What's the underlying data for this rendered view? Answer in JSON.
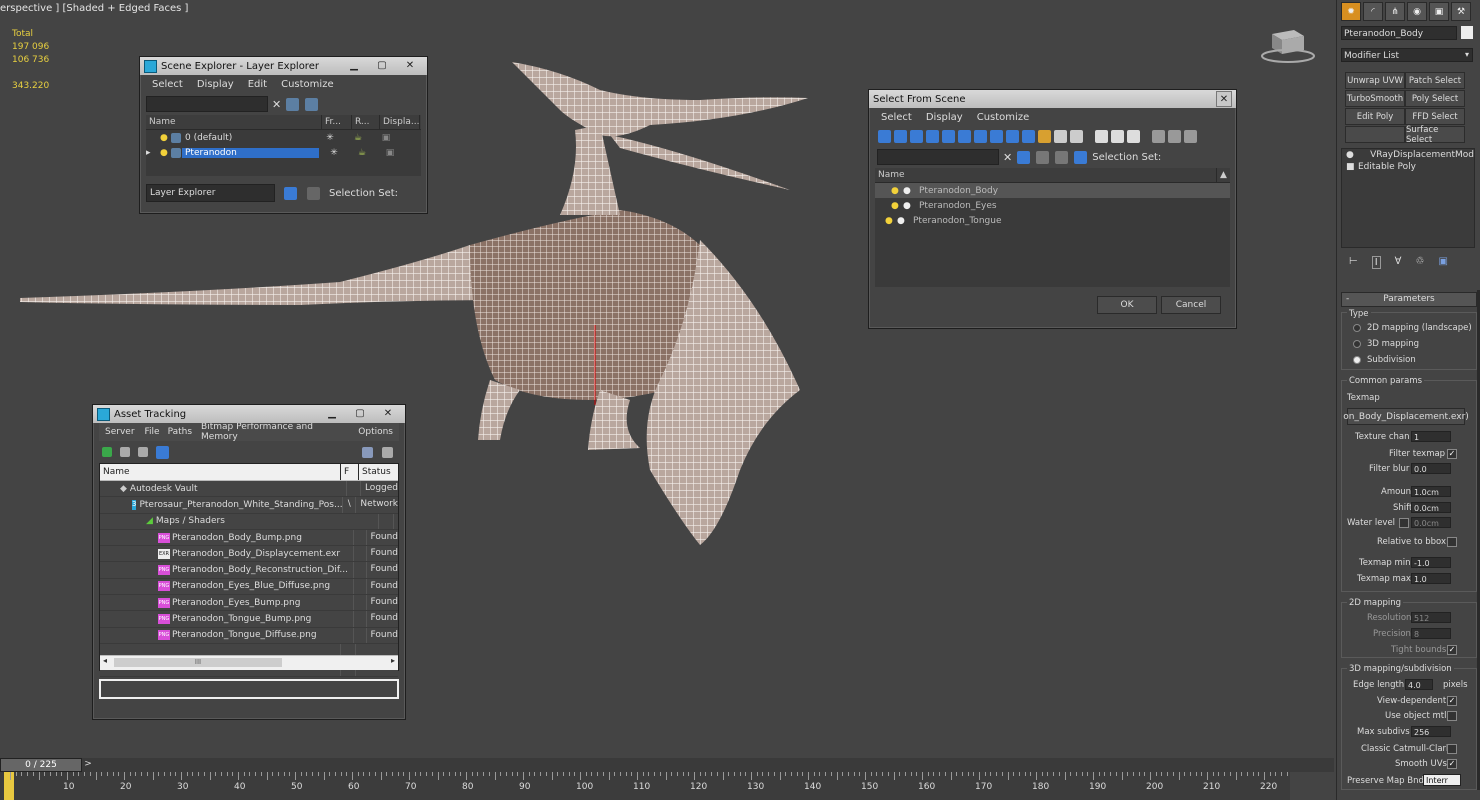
{
  "viewport": {
    "label": "erspective ] [Shaded + Edged Faces ]",
    "stats": [
      "Total",
      "197 096",
      "106 736",
      "",
      "343.220"
    ]
  },
  "scene_explorer": {
    "title": "Scene Explorer - Layer Explorer",
    "menu": [
      "Select",
      "Display",
      "Edit",
      "Customize"
    ],
    "columns": [
      "Name",
      "Fr...",
      "R...",
      "Displa..."
    ],
    "rows": [
      {
        "name": "0 (default)",
        "selected": false
      },
      {
        "name": "Pteranodon",
        "selected": true
      }
    ],
    "footer_dropdown": "Layer Explorer",
    "selection_set": "Selection Set:"
  },
  "select_from_scene": {
    "title": "Select From Scene",
    "menu": [
      "Select",
      "Display",
      "Customize"
    ],
    "selection_set": "Selection Set:",
    "column": "Name",
    "rows": [
      "Pteranodon_Body",
      "Pteranodon_Eyes",
      "Pteranodon_Tongue"
    ],
    "ok": "OK",
    "cancel": "Cancel"
  },
  "asset_tracking": {
    "title": "Asset Tracking",
    "menu": [
      "Server",
      "File",
      "Paths",
      "Bitmap Performance and Memory",
      "Options"
    ],
    "columns": [
      "Name",
      "F",
      "Status"
    ],
    "rows": [
      {
        "name": "Autodesk Vault",
        "f": "",
        "status": "Logged",
        "indent": 1,
        "icon": "vault"
      },
      {
        "name": "Pterosaur_Pteranodon_White_Standing_Pos...",
        "f": "\\",
        "status": "Network",
        "indent": 2,
        "icon": "max"
      },
      {
        "name": "Maps / Shaders",
        "f": "",
        "status": "",
        "indent": 3,
        "icon": "maps"
      },
      {
        "name": "Pteranodon_Body_Bump.png",
        "f": "",
        "status": "Found",
        "indent": 4,
        "icon": "png"
      },
      {
        "name": "Pteranodon_Body_Displaycement.exr",
        "f": "",
        "status": "Found",
        "indent": 4,
        "icon": "exr"
      },
      {
        "name": "Pteranodon_Body_Reconstruction_Dif...",
        "f": "",
        "status": "Found",
        "indent": 4,
        "icon": "png"
      },
      {
        "name": "Pteranodon_Eyes_Blue_Diffuse.png",
        "f": "",
        "status": "Found",
        "indent": 4,
        "icon": "png"
      },
      {
        "name": "Pteranodon_Eyes_Bump.png",
        "f": "",
        "status": "Found",
        "indent": 4,
        "icon": "png"
      },
      {
        "name": "Pteranodon_Tongue_Bump.png",
        "f": "",
        "status": "Found",
        "indent": 4,
        "icon": "png"
      },
      {
        "name": "Pteranodon_Tongue_Diffuse.png",
        "f": "",
        "status": "Found",
        "indent": 4,
        "icon": "png"
      }
    ],
    "scroll_label": "III"
  },
  "command_panel": {
    "object_name": "Pteranodon_Body",
    "modifier_list": "Modifier List",
    "modifier_buttons": [
      "Unwrap UVW",
      "Patch Select",
      "TurboSmooth",
      "Poly Select",
      "Edit Poly",
      "FFD Select",
      "",
      "Surface Select"
    ],
    "stack": [
      "VRayDisplacementMod",
      "Editable Poly"
    ],
    "rollout_title": "Parameters",
    "type_label": "Type",
    "type_options": [
      "2D mapping (landscape)",
      "3D mapping",
      "Subdivision"
    ],
    "common_params": "Common params",
    "texmap_label": "Texmap",
    "texmap_value": "on_Body_Displacement.exr)",
    "texture_chan_label": "Texture chan",
    "texture_chan": "1",
    "filter_texmap": "Filter texmap",
    "filter_blur_label": "Filter blur",
    "filter_blur": "0.0",
    "amount_label": "Amount",
    "amount": "1.0cm",
    "shift_label": "Shift",
    "shift": "0.0cm",
    "water_level_label": "Water level",
    "water_level": "0.0cm",
    "relative_bbox": "Relative to bbox",
    "texmap_min_label": "Texmap min",
    "texmap_min": "-1.0",
    "texmap_max_label": "Texmap max",
    "texmap_max": "1.0",
    "mapping2d": "2D mapping",
    "resolution_label": "Resolution",
    "resolution": "512",
    "precision_label": "Precision",
    "precision": "8",
    "tight_bounds": "Tight bounds",
    "mapping3d": "3D mapping/subdivision",
    "edge_length_label": "Edge length",
    "edge_length": "4.0",
    "pixels": "pixels",
    "view_dependent": "View-dependent",
    "use_object_mtl": "Use object mtl",
    "max_subdivs_label": "Max subdivs",
    "max_subdivs": "256",
    "classic_catmull": "Classic Catmull-Clark",
    "smooth_uvs": "Smooth UVs",
    "preserve_map_label": "Preserve Map Bnd",
    "preserve_map": "Interr"
  },
  "timeline": {
    "frame": "0 / 225",
    "next": ">",
    "ticks": [
      "10",
      "20",
      "30",
      "40",
      "50",
      "60",
      "70",
      "80",
      "90",
      "100",
      "110",
      "120",
      "130",
      "140",
      "150",
      "160",
      "170",
      "180",
      "190",
      "200",
      "210",
      "220"
    ]
  }
}
